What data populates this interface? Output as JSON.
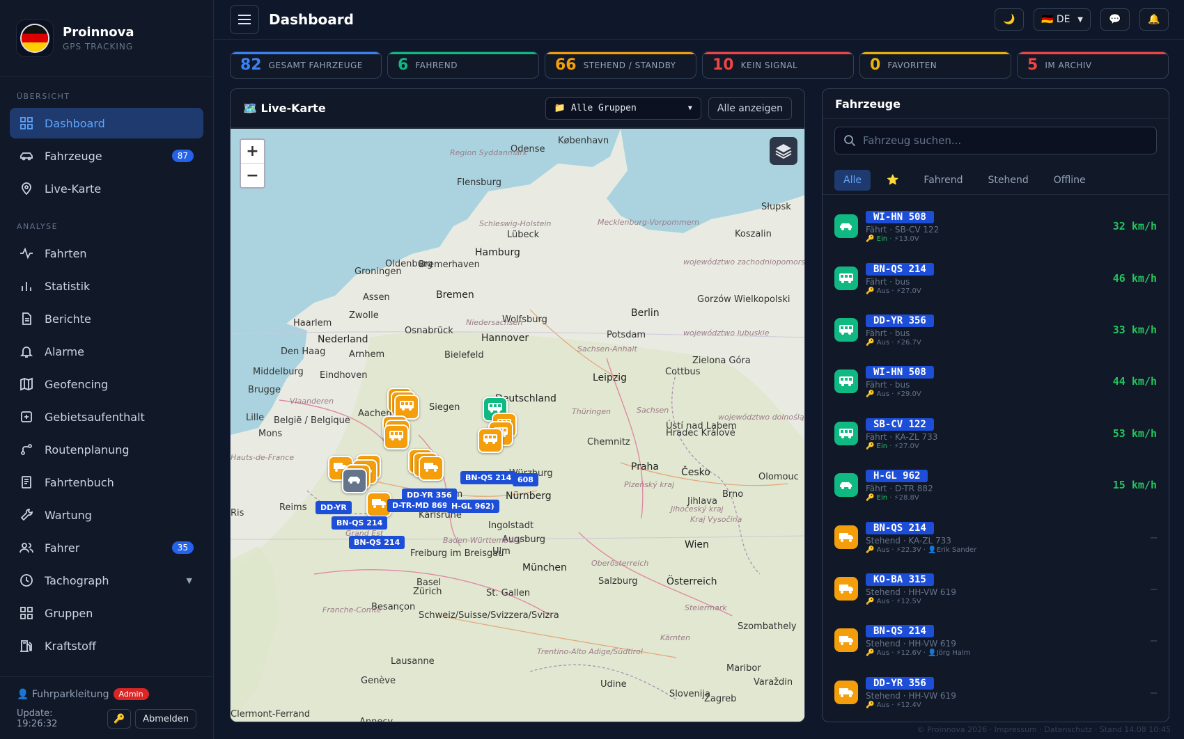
{
  "brand": {
    "name": "Proinnova",
    "sub": "GPS TRACKING"
  },
  "sidebar": {
    "section_overview": "ÜBERSICHT",
    "section_analysis": "ANALYSE",
    "items": [
      {
        "label": "Dashboard"
      },
      {
        "label": "Fahrzeuge",
        "badge": "87"
      },
      {
        "label": "Live-Karte"
      },
      {
        "label": "Fahrten"
      },
      {
        "label": "Statistik"
      },
      {
        "label": "Berichte"
      },
      {
        "label": "Alarme"
      },
      {
        "label": "Geofencing"
      },
      {
        "label": "Gebietsaufenthalt"
      },
      {
        "label": "Routenplanung"
      },
      {
        "label": "Fahrtenbuch"
      },
      {
        "label": "Wartung"
      },
      {
        "label": "Fahrer",
        "badge": "35"
      },
      {
        "label": "Tachograph"
      },
      {
        "label": "Gruppen"
      },
      {
        "label": "Kraftstoff"
      }
    ],
    "user": "👤 Fuhrparkleitung",
    "role": "Admin",
    "update": "Update: 19:26:32",
    "key_icon": "🔑",
    "logout": "Abmelden"
  },
  "header": {
    "title": "Dashboard",
    "theme_icon": "🌙",
    "lang": "🇩🇪 DE",
    "chat_icon": "💬",
    "bell_icon": "🔔"
  },
  "stats": [
    {
      "num": "82",
      "label": "GESAMT FAHRZEUGE",
      "color": "#3b82f6"
    },
    {
      "num": "6",
      "label": "FAHREND",
      "color": "#10b981"
    },
    {
      "num": "66",
      "label": "STEHEND / STANDBY",
      "color": "#f59e0b"
    },
    {
      "num": "10",
      "label": "KEIN SIGNAL",
      "color": "#ef4444"
    },
    {
      "num": "0",
      "label": "FAVORITEN",
      "color": "#eab308"
    },
    {
      "num": "5",
      "label": "IM ARCHIV",
      "color": "#ef4444"
    }
  ],
  "map": {
    "title": "🗺️ Live-Karte",
    "group": "📁 Alle Gruppen",
    "show_all": "Alle anzeigen",
    "zoom_in": "+",
    "zoom_out": "−",
    "cities": [
      "København",
      "Odense",
      "Flensburg",
      "Lübeck",
      "Hamburg",
      "Bremen",
      "Groningen",
      "Oldenburg",
      "Bremerhaven",
      "Assen",
      "Zwolle",
      "Haarlem",
      "Nederland",
      "Den Haag",
      "Arnhem",
      "Osnabrück",
      "Hannover",
      "Wolfsburg",
      "Berlin",
      "Potsdam",
      "Bielefeld",
      "Middelburg",
      "Eindhoven",
      "Brugge",
      "Lille",
      "België / Belgique",
      "Mons",
      "Siegen",
      "Leipzig",
      "Cottbus",
      "Zielona Góra",
      "Chemnitz",
      "Praha",
      "Ústí nad Labem",
      "Hradec Králové",
      "Würzburg",
      "Nürnberg",
      "Mannheim",
      "Karlsruhe",
      "Ingolstadt",
      "Augsburg",
      "Reims",
      "Ulm",
      "Freiburg im Breisgau",
      "München",
      "Basel",
      "Zürich",
      "St. Gallen",
      "Salzburg",
      "Österreich",
      "Wien",
      "Brno",
      "Česko",
      "Jihlava",
      "Olomouc",
      "Besançon",
      "Schweiz/Suisse/Svizzera/Svizra",
      "Lausanne",
      "Genève",
      "Udine",
      "Slovenija",
      "Zagreb",
      "Maribor",
      "Szombathely",
      "Słupsk",
      "Koszalin",
      "Gorzów Wielkopolski",
      "Deutschland",
      "Clermont-Ferrand",
      "Annecy",
      "Varaždin",
      "Ris",
      "Aachen"
    ],
    "regions": [
      "Region Syddanmark",
      "Schleswig-Holstein",
      "Mecklenburg-Vorpommern",
      "Niedersachsen",
      "Sachsen-Anhalt",
      "Thüringen",
      "Sachsen",
      "Baden-Württemberg",
      "Grand Est",
      "Oberösterreich",
      "Steiermark",
      "Kärnten",
      "Franche-Comté",
      "Hauts-de-France",
      "Vlaanderen",
      "Trentino-Alto Adige/Südtirol",
      "Kraj Vysočina",
      "Plzeňský kraj",
      "Jihočeský kraj",
      "województwo zachodniopomorskie",
      "województwo lubuskie",
      "województwo dolnośląskie"
    ],
    "labels": [
      "DD-YR",
      "BN-QS 214",
      "BN-QS 214",
      "D-TR-MD 869",
      "DD-YR 356",
      "BN-QS 214",
      "H-GL 962)",
      "608"
    ],
    "marker_colors": {
      "standing": "#f59e0b",
      "driving": "#10b981",
      "offline": "#64748b"
    }
  },
  "vehicles": {
    "title": "Fahrzeuge",
    "search_placeholder": "Fahrzeug suchen...",
    "filters": [
      "Alle",
      "⭐",
      "Fahrend",
      "Stehend",
      "Offline"
    ],
    "items": [
      {
        "plate": "WI-HN 508",
        "sub": "Fährt · SB-CV 122",
        "ign": "Ein",
        "volt": "⚡13.0V",
        "driver": "",
        "speed": "32 km/h",
        "type": "car",
        "status": "driving"
      },
      {
        "plate": "BN-QS 214",
        "sub": "Fährt · bus",
        "ign": "Aus",
        "volt": "⚡27.0V",
        "driver": "",
        "speed": "46 km/h",
        "type": "bus",
        "status": "driving"
      },
      {
        "plate": "DD-YR 356",
        "sub": "Fährt · bus",
        "ign": "Aus",
        "volt": "⚡26.7V",
        "driver": "",
        "speed": "33 km/h",
        "type": "bus",
        "status": "driving"
      },
      {
        "plate": "WI-HN 508",
        "sub": "Fährt · bus",
        "ign": "Aus",
        "volt": "⚡29.0V",
        "driver": "",
        "speed": "44 km/h",
        "type": "bus",
        "status": "driving"
      },
      {
        "plate": "SB-CV 122",
        "sub": "Fährt · KA-ZL 733",
        "ign": "Ein",
        "volt": "⚡27.0V",
        "driver": "",
        "speed": "53 km/h",
        "type": "bus",
        "status": "driving"
      },
      {
        "plate": "H-GL 962",
        "sub": "Fährt · D-TR 882",
        "ign": "Ein",
        "volt": "⚡28.8V",
        "driver": "",
        "speed": "15 km/h",
        "type": "car",
        "status": "driving"
      },
      {
        "plate": "BN-QS 214",
        "sub": "Stehend · KA-ZL 733",
        "ign": "Aus",
        "volt": "⚡22.3V",
        "driver": "👤Erik Sander",
        "speed": "–",
        "type": "truck",
        "status": "standing"
      },
      {
        "plate": "KO-BA 315",
        "sub": "Stehend · HH-VW 619",
        "ign": "Aus",
        "volt": "⚡12.5V",
        "driver": "",
        "speed": "–",
        "type": "truck",
        "status": "standing"
      },
      {
        "plate": "BN-QS 214",
        "sub": "Stehend · HH-VW 619",
        "ign": "Aus",
        "volt": "⚡12.6V",
        "driver": "👤Jörg Halm",
        "speed": "–",
        "type": "truck",
        "status": "standing"
      },
      {
        "plate": "DD-YR 356",
        "sub": "Stehend · HH-VW 619",
        "ign": "Aus",
        "volt": "⚡12.4V",
        "driver": "",
        "speed": "–",
        "type": "truck",
        "status": "standing"
      }
    ]
  },
  "footer": "© Proinnova 2026 · Impressum · Datenschutz · Stand 14.08 10:45"
}
